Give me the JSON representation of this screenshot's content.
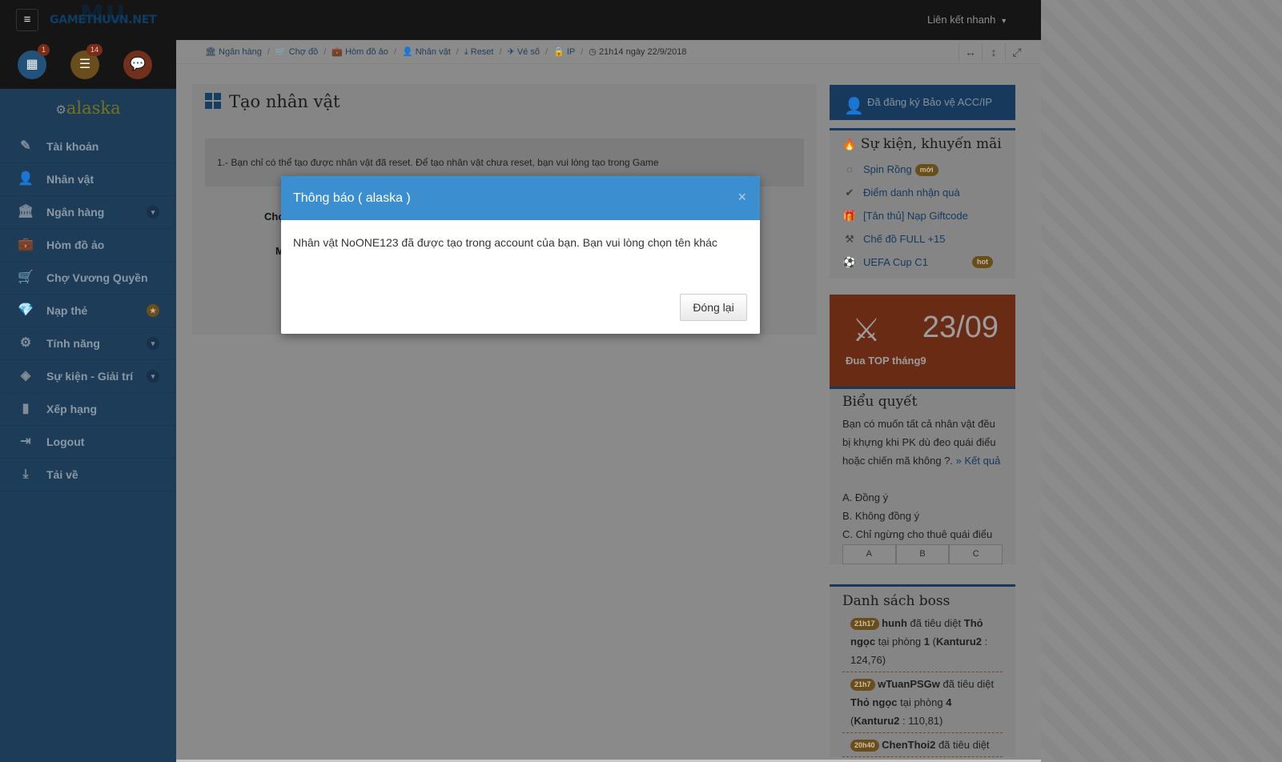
{
  "topbar": {
    "logo": "GAMETHUVN.NET",
    "logo_mark": "MU",
    "quick_links": "Liên kết nhanh",
    "menu_icon": "hamburger-icon"
  },
  "side_icons": [
    {
      "name": "calendar-icon",
      "glyph": "▦",
      "badge": "1",
      "color": "#22527a"
    },
    {
      "name": "server-icon",
      "glyph": "☰",
      "badge": "14",
      "color": "#6a4d1c"
    },
    {
      "name": "chat-icon",
      "glyph": "💬",
      "badge": "",
      "color": "#71301c"
    }
  ],
  "brand": "alaska",
  "nav": [
    {
      "label": "Tài khoản",
      "icon": "✎",
      "toggle": ""
    },
    {
      "label": "Nhân vật",
      "icon": "👤",
      "toggle": ""
    },
    {
      "label": "Ngân hàng",
      "icon": "🏛",
      "toggle": "▾"
    },
    {
      "label": "Hòm đồ ảo",
      "icon": "💼",
      "toggle": ""
    },
    {
      "label": "Chợ Vương Quyền",
      "icon": "🛒",
      "toggle": ""
    },
    {
      "label": "Nạp thẻ",
      "icon": "💎",
      "toggle": "★"
    },
    {
      "label": "Tính năng",
      "icon": "⚙",
      "toggle": "▾"
    },
    {
      "label": "Sự kiện - Giải trí",
      "icon": "◈",
      "toggle": "▾"
    },
    {
      "label": "Xếp hạng",
      "icon": "▮",
      "toggle": ""
    },
    {
      "label": "Logout",
      "icon": "⇥",
      "toggle": ""
    },
    {
      "label": "Tải về",
      "icon": "⤓",
      "toggle": ""
    }
  ],
  "breadcrumb": {
    "items": [
      "Ngân hàng",
      "Chợ đồ",
      "Hòm đồ ảo",
      "Nhân vật",
      "Reset",
      "Vé số",
      "IP"
    ],
    "time": "21h14 ngày 22/9/2018"
  },
  "panel": {
    "title": "Tạo nhân vật",
    "notice": "1.- Bạn chỉ có thể tạo được nhân vật đã reset. Để tạo nhân vật chưa reset, bạn vui lòng tạo trong Game",
    "frag1": "Chọ",
    "frag2": "M"
  },
  "right": {
    "register": "Đã đăng ký Bảo vệ ACC/IP",
    "events_title": "Sự kiện, khuyến mãi",
    "events": [
      {
        "label": "Spin Rồng",
        "icon": "spinner-icon",
        "glyph": "◌",
        "tag": "mới"
      },
      {
        "label": "Điểm danh nhận quà",
        "icon": "check-circle-icon",
        "glyph": "✔",
        "tag": ""
      },
      {
        "label": "[Tân thủ] Nạp Giftcode",
        "icon": "gift-icon",
        "glyph": "🎁",
        "tag": ""
      },
      {
        "label": "Chế đồ FULL +15",
        "icon": "hammer-icon",
        "glyph": "⚒",
        "tag": ""
      },
      {
        "label": "UEFA Cup C1",
        "icon": "soccer-ball-icon",
        "glyph": "⚽",
        "tag": "hot"
      }
    ],
    "top": {
      "date": "23/09",
      "label": "Đua TOP tháng9"
    },
    "vote": {
      "title": "Biểu quyết",
      "question": "Bạn có muốn tất cả nhân vật đều bị khựng khi PK dù đeo quái điểu hoặc chiến mã không ?.",
      "result_link": "» Kết quả",
      "options": [
        "A. Đồng ý",
        "B. Không đồng ý",
        "C. Chỉ ngừng cho thuê quái điểu"
      ],
      "buttons": [
        "A",
        "B",
        "C"
      ]
    },
    "boss": {
      "title": "Danh sách boss",
      "entries": [
        {
          "time": "21h17",
          "player": "hunh",
          "t1": " đã tiêu diệt ",
          "boss": "Thỏ ngọc",
          "t2": " tại phòng ",
          "room": "1",
          "map": "Kanturu2",
          "coord": " : 124,76)"
        },
        {
          "time": "21h7",
          "player": "wTuanPSGw",
          "t1": " đã tiêu diệt ",
          "boss": "Thỏ ngọc",
          "t2": " tại phòng ",
          "room": "4",
          "map": "Kanturu2",
          "coord": " : 110,81)"
        },
        {
          "time": "20h40",
          "player": "ChenThoi2",
          "t1": " đã tiêu diệt",
          "boss": "",
          "t2": "",
          "room": "",
          "map": "",
          "coord": ""
        }
      ]
    }
  },
  "dialog": {
    "title": "Thông báo ( alaska )",
    "message": "Nhân vật NoONE123 đã được tạo trong account của bạn. Bạn vui lòng chọn tên khác",
    "close_label": "Đóng lại",
    "close_icon": "×"
  }
}
